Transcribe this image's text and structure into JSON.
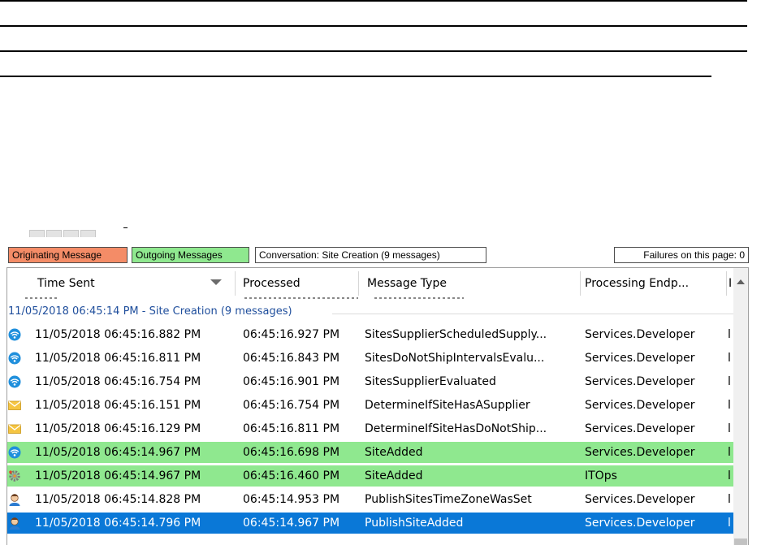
{
  "legend": {
    "originating": "Originating Message",
    "outgoing": "Outgoing Messages",
    "conversation": "Conversation: Site Creation (9 messages)",
    "failures": "Failures on this page: 0"
  },
  "colors": {
    "originating_bg": "#f48c67",
    "outgoing_bg": "#8fe88f",
    "selected_bg": "#0a78d7",
    "group_text": "#1f4e9c"
  },
  "columns": {
    "time_sent": "Time Sent",
    "processed": "Processed",
    "message_type": "Message Type",
    "processing_endpoint": "Processing Endp...",
    "extra": "I"
  },
  "group_header": "11/05/2018 06:45:14 PM - Site Creation (9 messages)",
  "rows": [
    {
      "icon": "wifi-icon",
      "time_sent": "11/05/2018 06:45:16.882 PM",
      "processed": "06:45:16.927 PM",
      "message_type": "SitesSupplierScheduledSupply...",
      "endpoint": "Services.Developer",
      "extra": "l",
      "style": "normal"
    },
    {
      "icon": "wifi-icon",
      "time_sent": "11/05/2018 06:45:16.811 PM",
      "processed": "06:45:16.843 PM",
      "message_type": "SitesDoNotShipIntervalsEvalu...",
      "endpoint": "Services.Developer",
      "extra": "l",
      "style": "normal"
    },
    {
      "icon": "wifi-icon",
      "time_sent": "11/05/2018 06:45:16.754 PM",
      "processed": "06:45:16.901 PM",
      "message_type": "SitesSupplierEvaluated",
      "endpoint": "Services.Developer",
      "extra": "l",
      "style": "normal"
    },
    {
      "icon": "envelope-icon",
      "time_sent": "11/05/2018 06:45:16.151 PM",
      "processed": "06:45:16.754 PM",
      "message_type": "DetermineIfSiteHasASupplier",
      "endpoint": "Services.Developer",
      "extra": "l",
      "style": "normal"
    },
    {
      "icon": "envelope-icon",
      "time_sent": "11/05/2018 06:45:16.129 PM",
      "processed": "06:45:16.811 PM",
      "message_type": "DetermineIfSiteHasDoNotShip...",
      "endpoint": "Services.Developer",
      "extra": "l",
      "style": "normal"
    },
    {
      "icon": "wifi-icon",
      "time_sent": "11/05/2018 06:45:14.967 PM",
      "processed": "06:45:16.698 PM",
      "message_type": "SiteAdded",
      "endpoint": "Services.Developer",
      "extra": "l",
      "style": "green"
    },
    {
      "icon": "gear-icon",
      "time_sent": "11/05/2018 06:45:14.967 PM",
      "processed": "06:45:16.460 PM",
      "message_type": "SiteAdded",
      "endpoint": "ITOps",
      "extra": "l",
      "style": "green"
    },
    {
      "icon": "person-icon",
      "time_sent": "11/05/2018 06:45:14.828 PM",
      "processed": "06:45:14.953 PM",
      "message_type": "PublishSitesTimeZoneWasSet",
      "endpoint": "Services.Developer",
      "extra": "l",
      "style": "normal"
    },
    {
      "icon": "person-icon",
      "time_sent": "11/05/2018 06:45:14.796 PM",
      "processed": "06:45:14.967 PM",
      "message_type": "PublishSiteAdded",
      "endpoint": "Services.Developer",
      "extra": "l",
      "style": "selected"
    }
  ]
}
